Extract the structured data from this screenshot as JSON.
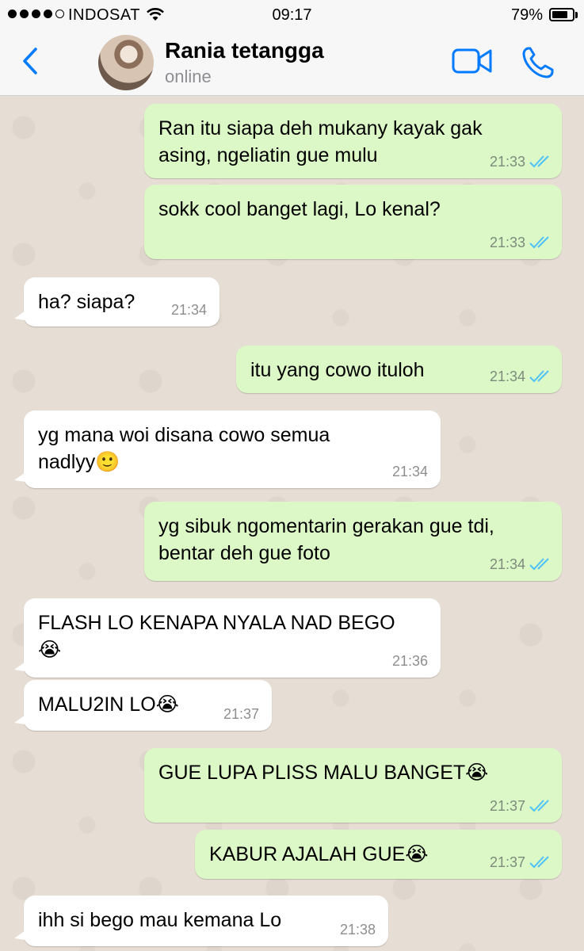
{
  "status_bar": {
    "carrier": "INDOSAT",
    "time": "09:17",
    "battery": "79%",
    "battery_level": 0.79,
    "signal_bars": 4
  },
  "header": {
    "back_icon": "chevron-left-icon",
    "contact_name": "Rania tetangga",
    "contact_status": "online",
    "video_icon": "video-camera-icon",
    "call_icon": "phone-icon",
    "accent_color": "#007aff"
  },
  "messages": [
    {
      "direction": "out",
      "text": "Ran itu siapa deh mukany kayak gak\nasing, ngeliatin gue mulu",
      "time": "21:33",
      "status": "read"
    },
    {
      "direction": "out",
      "text": "sokk cool banget lagi, Lo kenal?",
      "time": "21:33",
      "status": "read"
    },
    {
      "direction": "in",
      "text": "ha? siapa?",
      "time": "21:34"
    },
    {
      "direction": "out",
      "text": "itu yang cowo ituloh",
      "time": "21:34",
      "status": "read"
    },
    {
      "direction": "in",
      "text": "yg mana woi disana cowo semua\nnadlyy🙂",
      "time": "21:34"
    },
    {
      "direction": "out",
      "text": "yg sibuk ngomentarin gerakan gue tdi,\nbentar deh gue foto",
      "time": "21:34",
      "status": "read"
    },
    {
      "direction": "in",
      "text": "FLASH LO KENAPA NYALA NAD BEGO\n😭",
      "time": "21:36"
    },
    {
      "direction": "in",
      "text": "MALU2IN LO😭",
      "time": "21:37"
    },
    {
      "direction": "out",
      "text": "GUE LUPA PLISS MALU BANGET😭",
      "time": "21:37",
      "status": "read"
    },
    {
      "direction": "out",
      "text": "KABUR AJALAH GUE😭",
      "time": "21:37",
      "status": "read"
    },
    {
      "direction": "in",
      "text": "ihh si bego mau kemana Lo",
      "time": "21:38"
    }
  ],
  "colors": {
    "outgoing_bubble": "#dcf8c6",
    "incoming_bubble": "#ffffff",
    "read_ticks": "#4fc3f7",
    "chat_background": "#e6ddd4"
  }
}
